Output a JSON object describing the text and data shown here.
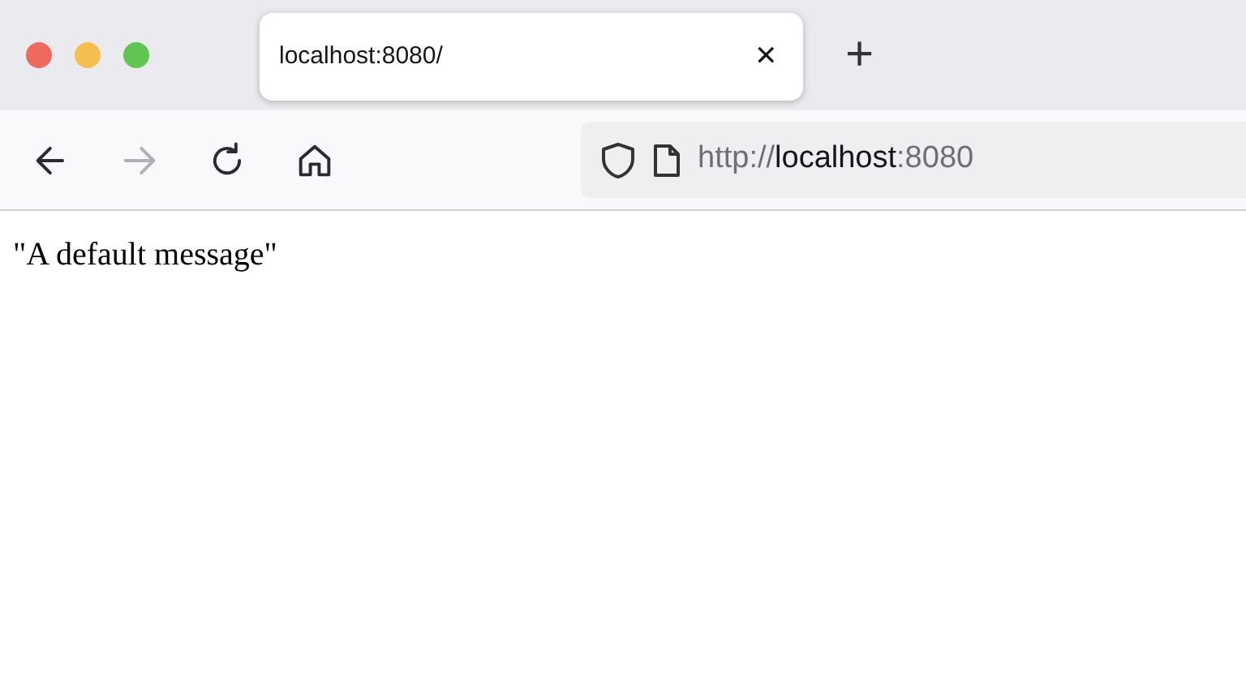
{
  "window": {
    "controls": [
      {
        "color": "#ec6a5e"
      },
      {
        "color": "#f4bf4f"
      },
      {
        "color": "#61c554"
      }
    ]
  },
  "tabs": [
    {
      "title": "localhost:8080/",
      "selected": true,
      "close": "✕"
    }
  ],
  "new_tab": "+",
  "toolbar": {
    "buttons": [
      {
        "kind": "back",
        "disabled": false
      },
      {
        "kind": "forward",
        "disabled": true
      },
      {
        "kind": "reload",
        "disabled": false
      },
      {
        "kind": "home",
        "disabled": false
      }
    ]
  },
  "address_bar": {
    "parts": [
      {
        "text": "http://",
        "emphasized": false
      },
      {
        "text": "localhost",
        "emphasized": true
      },
      {
        "text": ":8080",
        "emphasized": false
      }
    ]
  },
  "page": {
    "text": "\"A default message\""
  }
}
